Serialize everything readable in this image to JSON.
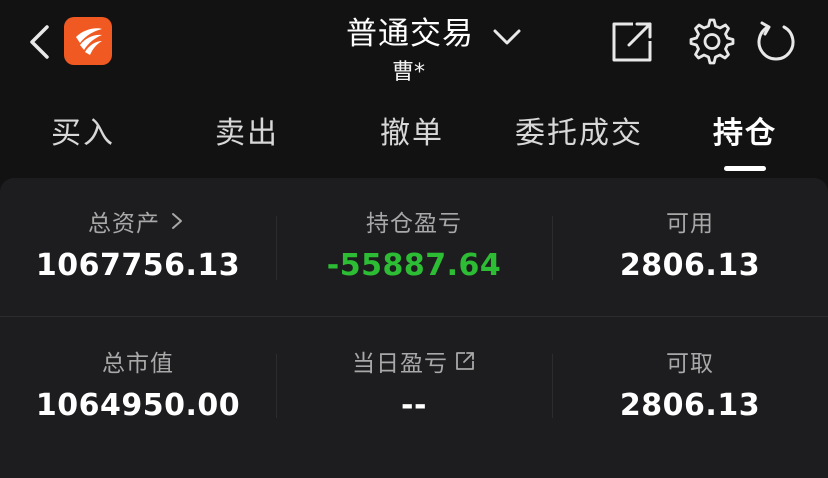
{
  "header": {
    "title": "普通交易",
    "account": "曹*"
  },
  "icons": {
    "back": "chevron-left-icon",
    "logo": "app-logo-icon",
    "title_dropdown": "chevron-down-icon",
    "share": "share-external-icon",
    "settings": "gear-icon",
    "refresh": "refresh-icon"
  },
  "tabs": [
    {
      "label": "买入",
      "active": false
    },
    {
      "label": "卖出",
      "active": false
    },
    {
      "label": "撤单",
      "active": false
    },
    {
      "label": "委托成交",
      "active": false
    },
    {
      "label": "持仓",
      "active": true
    }
  ],
  "summary": {
    "total_assets": {
      "label": "总资产",
      "value": "1067756.13"
    },
    "position_pnl": {
      "label": "持仓盈亏",
      "value": "-55887.64"
    },
    "available": {
      "label": "可用",
      "value": "2806.13"
    },
    "market_value": {
      "label": "总市值",
      "value": "1064950.00"
    },
    "daily_pnl": {
      "label": "当日盈亏",
      "value": "--"
    },
    "withdrawable": {
      "label": "可取",
      "value": "2806.13"
    }
  },
  "colors": {
    "background": "#121212",
    "card": "#1d1d1f",
    "logo": "#f05a22",
    "loss": "#2dbd34",
    "label": "#a8a8a8"
  }
}
